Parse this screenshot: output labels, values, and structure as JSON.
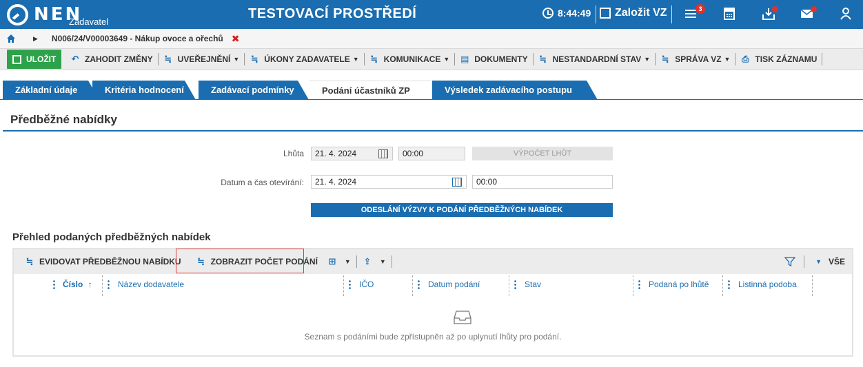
{
  "header": {
    "logo_text": "NEN",
    "logo_sub": "Zadavatel",
    "env_title": "TESTOVACÍ PROSTŘEDÍ",
    "clock": "8:44:49",
    "create_vz": "Založit VZ",
    "menu_badge": "3"
  },
  "breadcrumb": {
    "text": "N006/24/V00003649 - Nákup ovoce a ořechů",
    "close": "✖"
  },
  "toolbar": {
    "save": "ULOŽIT",
    "discard": "ZAHODIT ZMĚNY",
    "publish": "UVEŘEJNĚNÍ",
    "actions": "ÚKONY ZADAVATELE",
    "communication": "KOMUNIKACE",
    "documents": "DOKUMENTY",
    "nonstandard": "NESTANDARDNÍ STAV",
    "admin": "SPRÁVA VZ",
    "print": "TISK ZÁZNAMU"
  },
  "tabs": [
    {
      "label": "Základní údaje"
    },
    {
      "label": "Kritéria hodnocení"
    },
    {
      "label": "Zadávací podmínky"
    },
    {
      "label": "Podání účastníků ZP"
    },
    {
      "label": "Výsledek zadávacího postupu"
    }
  ],
  "section": {
    "title": "Předběžné nabídky"
  },
  "form": {
    "deadline_label": "Lhůta",
    "deadline_date": "21. 4. 2024",
    "deadline_time": "00:00",
    "calc_button": "VÝPOČET LHŮT",
    "opening_label": "Datum a čas otevírání:",
    "opening_date": "21. 4. 2024",
    "opening_time": "00:00",
    "send_button": "ODESLÁNÍ VÝZVY K PODÁNÍ PŘEDBĚŽNÝCH NABÍDEK"
  },
  "overview": {
    "title": "Přehled podaných předběžných nabídek",
    "btn_register": "EVIDOVAT PŘEDBĚŽNOU NABÍDKU",
    "btn_count": "ZOBRAZIT POČET PODÁNÍ",
    "all_label": "VŠE",
    "columns": [
      "Číslo",
      "Název dodavatele",
      "IČO",
      "Datum podání",
      "Stav",
      "Podaná po lhůtě",
      "Listinná podoba"
    ],
    "sort_indicator": "↑",
    "empty_text": "Seznam s podáními bude zpřístupněn až po uplynutí lhůty pro podání."
  },
  "colors": {
    "primary": "#1a6db0",
    "save_green": "#2ea24a",
    "alert_red": "#e0312c"
  }
}
